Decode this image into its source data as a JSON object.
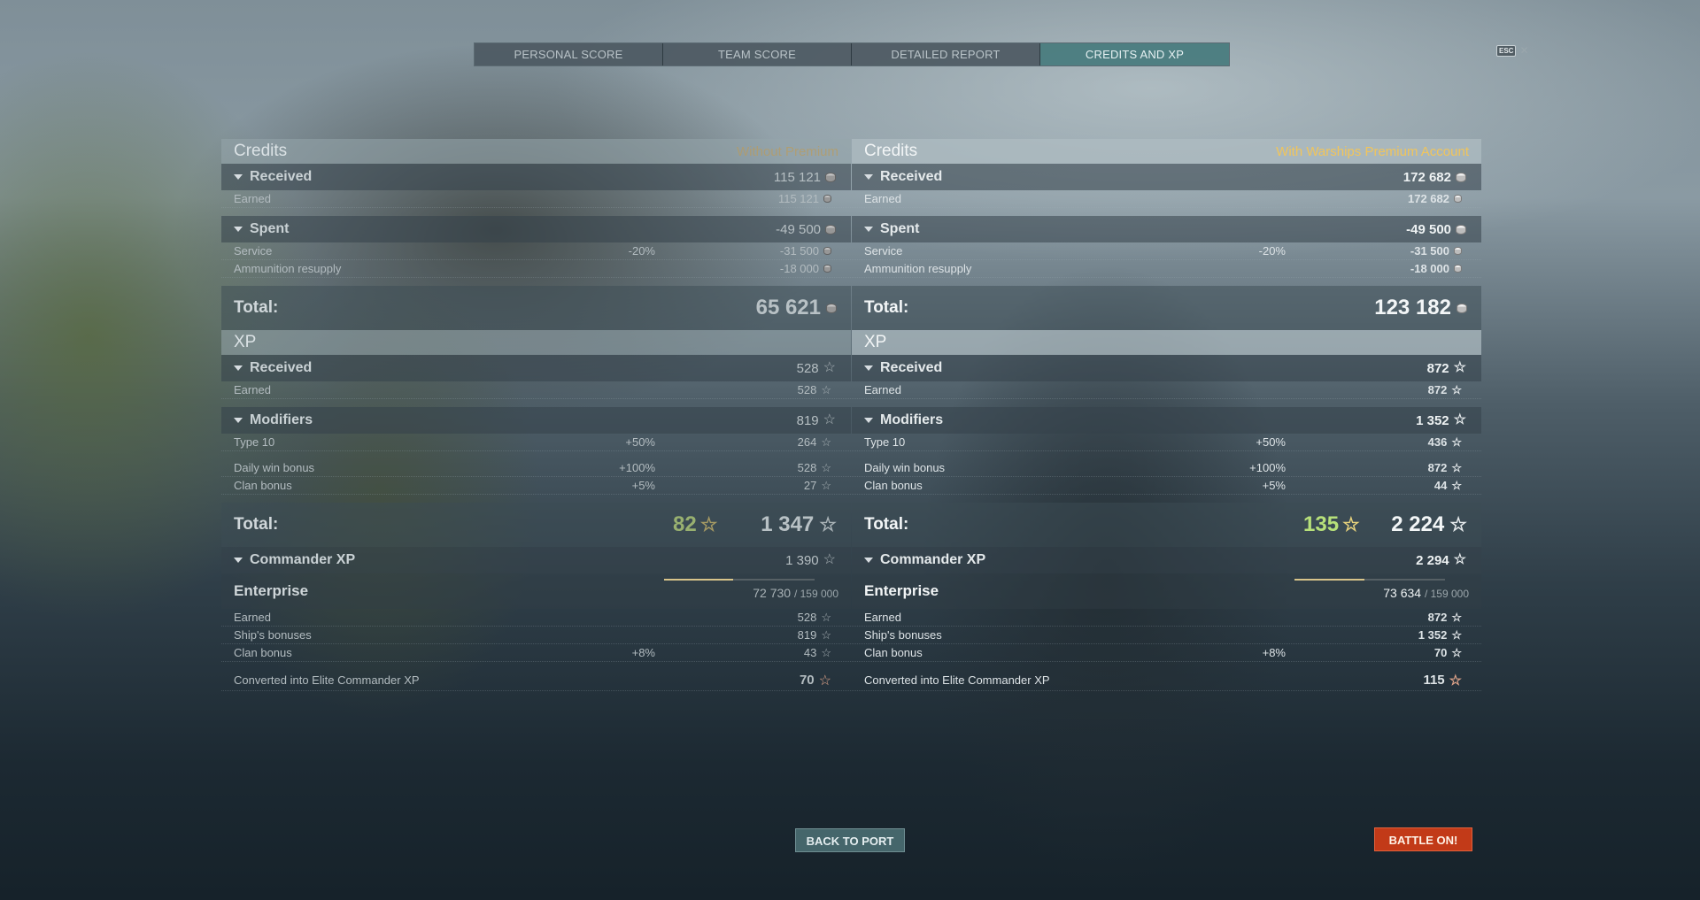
{
  "tabs": [
    "PERSONAL SCORE",
    "TEAM SCORE",
    "DETAILED REPORT",
    "CREDITS AND XP"
  ],
  "active_tab": "CREDITS AND XP",
  "esc_label": "ESC",
  "close_glyph": "✕",
  "left": {
    "credits_title": "Credits",
    "credits_note": "Without Premium",
    "received_label": "Received",
    "received_value": "115 121",
    "earned_label": "Earned",
    "earned_value": "115 121",
    "spent_label": "Spent",
    "spent_value": "-49 500",
    "service_label": "Service",
    "service_pct": "-20%",
    "service_value": "-31 500",
    "ammo_label": "Ammunition resupply",
    "ammo_value": "-18 000",
    "total_label": "Total:",
    "credits_total": "65 621",
    "xp_title": "XP",
    "xp_received_label": "Received",
    "xp_received_value": "528",
    "xp_earned_label": "Earned",
    "xp_earned_value": "528",
    "modifiers_label": "Modifiers",
    "modifiers_value": "819",
    "type10_label": "Type 10",
    "type10_pct": "+50%",
    "type10_value": "264",
    "daily_label": "Daily win bonus",
    "daily_pct": "+100%",
    "daily_value": "528",
    "clan_label": "Clan bonus",
    "clan_pct": "+5%",
    "clan_value": "27",
    "free_xp": "82",
    "xp_total": "1 347",
    "cmd_label": "Commander XP",
    "cmd_value": "1 390",
    "cmd_name": "Enterprise",
    "cmd_xp": "72 730",
    "cmd_xp_max": "/ 159 000",
    "cmd_progress": 0.457,
    "c_earned_label": "Earned",
    "c_earned_value": "528",
    "c_ship_label": "Ship's bonuses",
    "c_ship_value": "819",
    "c_clan_label": "Clan bonus",
    "c_clan_pct": "+8%",
    "c_clan_value": "43",
    "convert_label": "Converted into Elite Commander XP",
    "convert_value": "70"
  },
  "right": {
    "credits_title": "Credits",
    "credits_note": "With Warships Premium Account",
    "received_label": "Received",
    "received_value": "172 682",
    "earned_label": "Earned",
    "earned_value": "172 682",
    "spent_label": "Spent",
    "spent_value": "-49 500",
    "service_label": "Service",
    "service_pct": "-20%",
    "service_value": "-31 500",
    "ammo_label": "Ammunition resupply",
    "ammo_value": "-18 000",
    "total_label": "Total:",
    "credits_total": "123 182",
    "xp_title": "XP",
    "xp_received_label": "Received",
    "xp_received_value": "872",
    "xp_earned_label": "Earned",
    "xp_earned_value": "872",
    "modifiers_label": "Modifiers",
    "modifiers_value": "1 352",
    "type10_label": "Type 10",
    "type10_pct": "+50%",
    "type10_value": "436",
    "daily_label": "Daily win bonus",
    "daily_pct": "+100%",
    "daily_value": "872",
    "clan_label": "Clan bonus",
    "clan_pct": "+5%",
    "clan_value": "44",
    "free_xp": "135",
    "xp_total": "2 224",
    "cmd_label": "Commander XP",
    "cmd_value": "2 294",
    "cmd_name": "Enterprise",
    "cmd_xp": "73 634",
    "cmd_xp_max": "/ 159 000",
    "cmd_progress": 0.463,
    "c_earned_label": "Earned",
    "c_earned_value": "872",
    "c_ship_label": "Ship's bonuses",
    "c_ship_value": "1 352",
    "c_clan_label": "Clan bonus",
    "c_clan_pct": "+8%",
    "c_clan_value": "70",
    "convert_label": "Converted into Elite Commander XP",
    "convert_value": "115"
  },
  "buttons": {
    "back_to_port": "BACK TO PORT",
    "battle": "BATTLE ON!"
  },
  "icons": {
    "credits": "credits-coin-icon",
    "xp": "star-icon",
    "free_xp": "star-icon",
    "elite": "elite-commander-icon",
    "expand": "triangle-down-icon"
  },
  "colors": {
    "active_tab": "#4a7c7e",
    "premium_note": "#f1c55b",
    "free_xp": "#b7e07a",
    "battle_button": "#c23a18"
  }
}
